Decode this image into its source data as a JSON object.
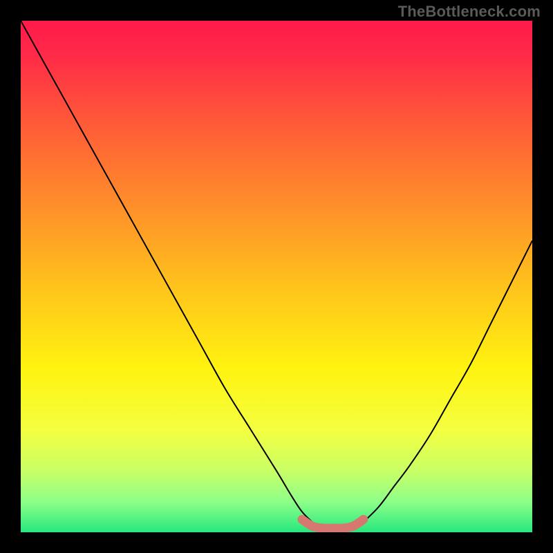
{
  "watermark": "TheBottleneck.com",
  "chart_data": {
    "type": "line",
    "title": "",
    "xlabel": "",
    "ylabel": "",
    "xlim": [
      0,
      100
    ],
    "ylim": [
      0,
      100
    ],
    "grid": false,
    "legend": false,
    "series": [
      {
        "name": "curve-left",
        "stroke": "#000000",
        "x": [
          0,
          5,
          10,
          15,
          20,
          25,
          30,
          35,
          40,
          45,
          50,
          53,
          55,
          57
        ],
        "values": [
          100,
          91,
          82,
          73,
          64,
          55,
          46,
          37,
          28,
          20,
          12,
          7,
          4,
          2
        ]
      },
      {
        "name": "curve-right",
        "stroke": "#000000",
        "x": [
          67,
          70,
          73,
          76,
          80,
          84,
          88,
          92,
          96,
          100
        ],
        "values": [
          2,
          5,
          9,
          13,
          19,
          26,
          33,
          41,
          49,
          57
        ]
      },
      {
        "name": "bottom-highlight",
        "stroke": "#d6786f",
        "x": [
          55,
          57,
          59,
          61,
          63,
          65,
          67
        ],
        "values": [
          2.5,
          1.2,
          0.8,
          0.8,
          0.8,
          1.2,
          2.5
        ]
      }
    ],
    "gradient_stops": [
      {
        "offset": 0.0,
        "color": "#ff1a4b"
      },
      {
        "offset": 0.06,
        "color": "#ff2848"
      },
      {
        "offset": 0.2,
        "color": "#ff5a38"
      },
      {
        "offset": 0.36,
        "color": "#ff8e2a"
      },
      {
        "offset": 0.52,
        "color": "#ffc31c"
      },
      {
        "offset": 0.68,
        "color": "#fff310"
      },
      {
        "offset": 0.8,
        "color": "#f4ff40"
      },
      {
        "offset": 0.88,
        "color": "#c9ff66"
      },
      {
        "offset": 0.94,
        "color": "#8eff88"
      },
      {
        "offset": 1.0,
        "color": "#26e87e"
      }
    ]
  }
}
